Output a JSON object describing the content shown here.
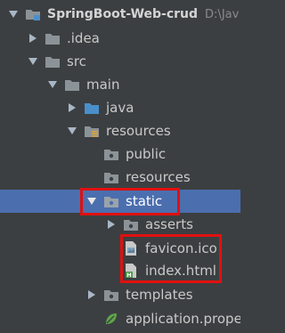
{
  "project": {
    "name": "SpringBoot-Web-crud",
    "path": "D:\\Jav"
  },
  "tree": {
    "idea": ".idea",
    "src": "src",
    "main": "main",
    "java": "java",
    "resources": "resources",
    "public": "public",
    "resources_inner": "resources",
    "static": "static",
    "asserts": "asserts",
    "favicon": "favicon.ico",
    "index": "index.html",
    "templates": "templates",
    "application": "application.prope"
  },
  "colors": {
    "background": "#3c3f41",
    "selection": "#4b6eaf",
    "highlight": "#e01010",
    "folder": "#8c9398",
    "source_folder": "#4a8fc9"
  }
}
